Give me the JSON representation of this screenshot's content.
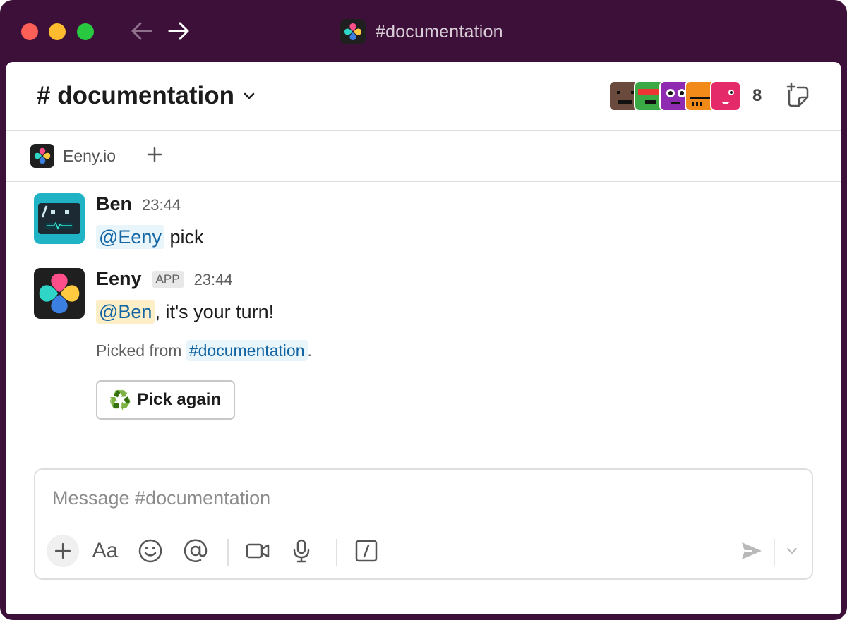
{
  "window": {
    "title": "#documentation"
  },
  "channel": {
    "name": "# documentation",
    "member_count": "8"
  },
  "bookmarks": {
    "items": [
      {
        "label": "Eeny.io"
      }
    ]
  },
  "messages": [
    {
      "sender": "Ben",
      "time": "23:44",
      "mention": "@Eeny",
      "text": " pick"
    },
    {
      "sender": "Eeny",
      "badge": "APP",
      "time": "23:44",
      "mention": "@Ben",
      "text": ", it's your turn!",
      "context_prefix": "Picked from ",
      "context_channel": "#documentation",
      "context_suffix": ".",
      "button_emoji": "♻️",
      "button_label": "Pick again"
    }
  ],
  "composer": {
    "placeholder": "Message #documentation",
    "format_label": "Aa"
  },
  "colors": {
    "titlebar": "#3d1039",
    "mention_text": "#1264a3",
    "mention_bg": "#e8f5fa",
    "mention_me_bg": "#fcefc8"
  },
  "icons": {
    "back": "arrow-left-icon",
    "forward": "arrow-right-icon",
    "chevron": "chevron-down-icon",
    "canvas": "canvas-add-icon",
    "add": "plus-icon",
    "emoji": "emoji-icon",
    "mention": "at-icon",
    "video": "video-icon",
    "mic": "microphone-icon",
    "shortcut": "slash-command-icon",
    "send": "send-icon",
    "send_options": "chevron-down-icon"
  }
}
